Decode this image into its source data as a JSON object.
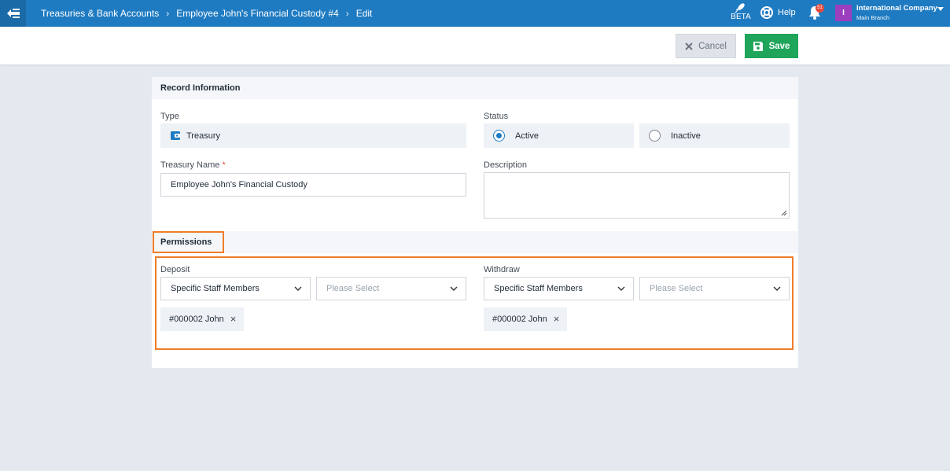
{
  "topbar": {
    "breadcrumb": [
      "Treasuries & Bank Accounts",
      "Employee John's Financial Custody #4",
      "Edit"
    ],
    "beta_label": "BETA",
    "help_label": "Help",
    "notification_count": "51",
    "avatar_letter": "I",
    "company_name": "International Company",
    "branch_name": "Main Branch"
  },
  "actions": {
    "cancel_label": "Cancel",
    "save_label": "Save"
  },
  "record_info": {
    "section_title": "Record Information",
    "type_label": "Type",
    "type_value": "Treasury",
    "status_label": "Status",
    "status_options": [
      "Active",
      "Inactive"
    ],
    "status_selected": "Active",
    "name_label": "Treasury Name",
    "name_required_mark": "*",
    "name_value": "Employee John's Financial Custody",
    "description_label": "Description",
    "description_value": ""
  },
  "permissions": {
    "section_title": "Permissions",
    "deposit": {
      "label": "Deposit",
      "mode": "Specific Staff Members",
      "placeholder": "Please Select",
      "tags": [
        "#000002 John"
      ]
    },
    "withdraw": {
      "label": "Withdraw",
      "mode": "Specific Staff Members",
      "placeholder": "Please Select",
      "tags": [
        "#000002 John"
      ]
    }
  },
  "colors": {
    "topbar": "#1f7bc1",
    "save": "#1fa55a",
    "highlight": "#ef7d2b",
    "badge": "#e64a3b",
    "avatar": "#9b3fbf"
  }
}
